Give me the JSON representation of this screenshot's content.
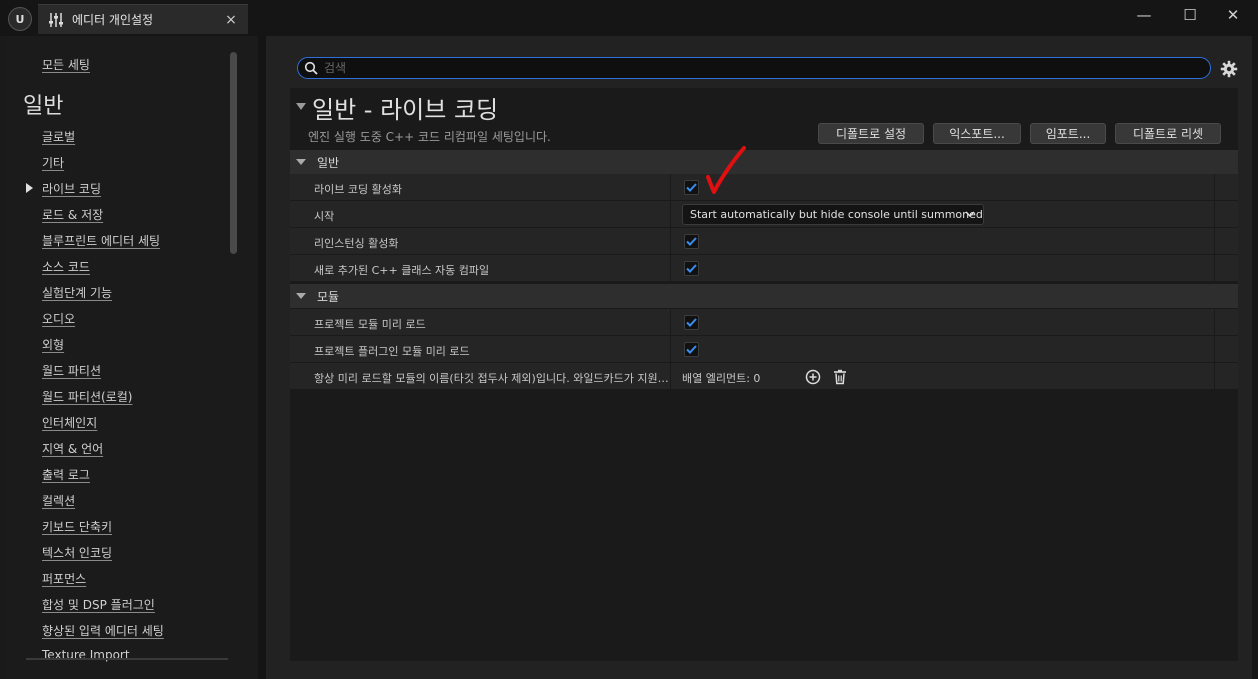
{
  "window": {
    "logo_text": "U",
    "tab_title": "에디터 개인설정",
    "tab_close": "×",
    "minimize": "—",
    "maximize": "☐",
    "close": "✕"
  },
  "sidebar": {
    "all_settings": "모든 세팅",
    "heading": "일반",
    "items": [
      "글로벌",
      "기타",
      "라이브 코딩",
      "로드 & 저장",
      "블루프린트 에디터 세팅",
      "소스 코드",
      "실험단계 기능",
      "오디오",
      "외형",
      "월드 파티션",
      "월드 파티션(로컬)",
      "인터체인지",
      "지역 & 언어",
      "출력 로그",
      "컬렉션",
      "키보드 단축키",
      "텍스처 인코딩",
      "퍼포먼스",
      "합성 및 DSP 플러그인",
      "향상된 입력 에디터 세팅",
      "Texture Import"
    ],
    "selected_index": 2
  },
  "search": {
    "placeholder": "검색",
    "value": ""
  },
  "page": {
    "title": "일반 - 라이브 코딩",
    "description": "엔진 실행 도중 C++ 코드 리컴파일 세팅입니다.",
    "buttons": {
      "set_default": "디폴트로 설정",
      "export": "익스포트...",
      "import": "임포트...",
      "reset_default": "디폴트로 리셋"
    }
  },
  "categories": {
    "general": {
      "label": "일반",
      "rows": {
        "enable_live_coding": {
          "label": "라이브 코딩 활성화",
          "checked": true
        },
        "startup": {
          "label": "시작",
          "value": "Start automatically but hide console until summoned"
        },
        "enable_reinstancing": {
          "label": "리인스턴싱 활성화",
          "checked": true
        },
        "auto_compile_new_classes": {
          "label": "새로 추가된 C++ 클래스 자동 컴파일",
          "checked": true
        }
      }
    },
    "modules": {
      "label": "모듈",
      "rows": {
        "preload_project_modules": {
          "label": "프로젝트 모듈 미리 로드",
          "checked": true
        },
        "preload_project_plugin_modules": {
          "label": "프로젝트 플러그인 모듈 미리 로드",
          "checked": true
        },
        "always_preload_modules": {
          "label": "항상 미리 로드할 모듈의 이름(타깃 접두사 제외)입니다.  와일드카드가 지원됩니다.",
          "array_text": "배열 엘리먼트: 0"
        }
      }
    }
  },
  "colors": {
    "accent": "#2f6fdc",
    "check": "#3a8ef0",
    "annotation": "#e01010"
  }
}
